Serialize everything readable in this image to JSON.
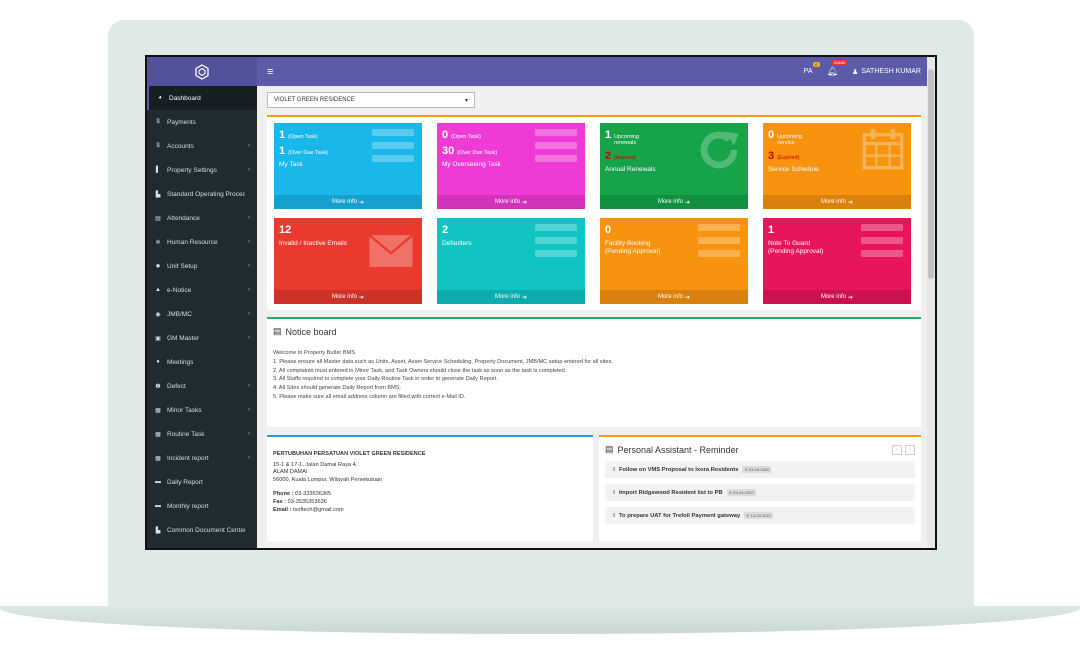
{
  "topbar": {
    "menu_icon": "≡",
    "pa_label": "PA",
    "pa_badge": "0",
    "bell_badge": "31486",
    "user_name": "SATHESH KUMAR"
  },
  "sidebar": {
    "items": [
      {
        "label": "Dashboard",
        "icon": "◕",
        "chev": ""
      },
      {
        "label": "Payments",
        "icon": "$",
        "chev": ""
      },
      {
        "label": "Accounts",
        "icon": "$",
        "chev": "‹"
      },
      {
        "label": "Property Settings",
        "icon": "▌",
        "chev": "‹"
      },
      {
        "label": "Standard Operating Procedure",
        "icon": "▙",
        "chev": ""
      },
      {
        "label": "Attendance",
        "icon": "▤",
        "chev": "‹"
      },
      {
        "label": "Human Resource",
        "icon": "✲",
        "chev": "‹"
      },
      {
        "label": "Unit Setup",
        "icon": "✹",
        "chev": "‹"
      },
      {
        "label": "e-Notice",
        "icon": "▲",
        "chev": "‹"
      },
      {
        "label": "JMB/MC",
        "icon": "◉",
        "chev": "‹"
      },
      {
        "label": "GM Master",
        "icon": "▣",
        "chev": "‹"
      },
      {
        "label": "Meetings",
        "icon": "●",
        "chev": ""
      },
      {
        "label": "Defect",
        "icon": "❶",
        "chev": "‹"
      },
      {
        "label": "Minor Tasks",
        "icon": "▦",
        "chev": "‹"
      },
      {
        "label": "Routine Task",
        "icon": "▦",
        "chev": "‹"
      },
      {
        "label": "Incident report",
        "icon": "▦",
        "chev": "‹"
      },
      {
        "label": "Daily Report",
        "icon": "▬",
        "chev": ""
      },
      {
        "label": "Monthly report",
        "icon": "▬",
        "chev": ""
      },
      {
        "label": "Common Document Center",
        "icon": "▙",
        "chev": ""
      }
    ]
  },
  "site_select": {
    "value": "VIOLET GREEN RESIDENCE",
    "arrow": "▾"
  },
  "tiles": {
    "more_info": "More info",
    "more_icon": "➔",
    "t1": {
      "n1": "1",
      "l1": "(Open Task)",
      "n2": "1",
      "l2": "(Over Due Task)",
      "caption": "My Task",
      "color": "#1ab7ea"
    },
    "t2": {
      "n1": "0",
      "l1": "(Open Task)",
      "n2": "30",
      "l2": "(Over Due Task)",
      "caption": "My Overseeing Task",
      "color": "#ee3bd5"
    },
    "t3": {
      "n1": "1",
      "l1": "Upcoming renewals",
      "n2": "2",
      "l2": "(Expired)",
      "caption": "Annual Renewals",
      "color": "#16a34a"
    },
    "t4": {
      "n1": "0",
      "l1": "Upcoming service",
      "n2": "3",
      "l2": "(Expired)",
      "caption": "Service Schedule",
      "color": "#f7930e"
    },
    "t5": {
      "n1": "12",
      "caption": "Invalid / Inactive Emails",
      "color": "#ea3a2e"
    },
    "t6": {
      "n1": "2",
      "caption": "Defaulters",
      "color": "#10c4c4"
    },
    "t7": {
      "n1": "0",
      "caption1": "Facility Booking",
      "caption2": "(Pending Approval)",
      "color": "#f7930e"
    },
    "t8": {
      "n1": "1",
      "caption1": "Note To Guard",
      "caption2": "(Pending Approval)",
      "color": "#e7155a"
    }
  },
  "notice": {
    "title": "Notice board",
    "lines": [
      "Welcome to Property Butler BMS",
      "1. Please ensure all Master data such as Units, Asset, Asset Service Scheduling, Property Document, JMB/MC setup entered for all sites.",
      "2. All complaints must entered in Minor Task, and Task Owners should close the task as soon as the task is completed.",
      "3. All Staffs required to complete your Daily Routine Task in order to generate Daily Report.",
      "4. All Sites should generate Daily Report from BMS.",
      "5. Please make sure all email address column are filled with correct e-Mail ID."
    ]
  },
  "address": {
    "title": "PERTUBUHAN PERSATUAN VIOLET GREEN RESIDENCE",
    "line1": "15-1 & 17-1, Jalan Damai Raya 4,",
    "line2": "ALAM DAMAI",
    "line3": "56000, Kuala Lumpur, Wilayah Persekutuan",
    "phone_label": "Phone :",
    "phone": "03-333636365",
    "fax_label": "Fax :",
    "fax": "03-3535353636",
    "email_label": "Email :",
    "email": "tsoftech@gmail.com"
  },
  "assistant": {
    "title": "Personal Assistant - Reminder",
    "prev": "‹",
    "next": "›",
    "reminders": [
      {
        "text": "Follow on VMS Proposal to Ixora Residents",
        "date": "⊙ 03-04-2020"
      },
      {
        "text": "Import Ridgewood Resident list to PB",
        "date": "⊙ 03-04-2020"
      },
      {
        "text": "To prepare UAT for Trefoil Payment gateway",
        "date": "⊙ 14-03-2021"
      }
    ]
  }
}
